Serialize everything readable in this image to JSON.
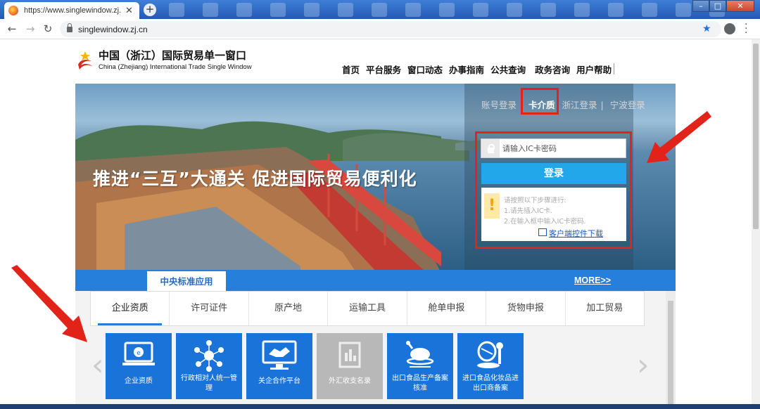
{
  "browser": {
    "tab_title": "https://www.singlewindow.zj.c",
    "url": "singlewindow.zj.cn"
  },
  "header": {
    "logo_cn": "中国（浙江）国际贸易单一窗口",
    "logo_en": "China (Zhejiang) International Trade Single Window",
    "nav": [
      "首页",
      "平台服务",
      "窗口动态",
      "办事指南",
      "公共查询",
      "政务咨询",
      "用户帮助"
    ]
  },
  "banner": {
    "slogan": "推进“三互”大通关  促进国际贸易便利化"
  },
  "login": {
    "tabs": [
      "账号登录",
      "卡介质",
      "浙江登录",
      "宁波登录"
    ],
    "active_tab": "卡介质",
    "ic_placeholder": "请输入IC卡密码",
    "login_button": "登录",
    "tips": [
      "请按照以下步骤进行:",
      "1.请先插入IC卡.",
      "2.在输入框中输入IC卡密码."
    ],
    "download_link": "客户端控件下载"
  },
  "apps": {
    "section_tab": "中央标准应用",
    "more": "MORE>>",
    "categories": [
      "企业资质",
      "许可证件",
      "原产地",
      "运输工具",
      "舱单申报",
      "货物申报",
      "加工贸易"
    ],
    "tiles": [
      {
        "label": "企业资质",
        "icon": "monitor-icon",
        "disabled": false
      },
      {
        "label": "行政相对人统一管理",
        "icon": "people-network-icon",
        "disabled": false
      },
      {
        "label": "关企合作平台",
        "icon": "handshake-icon",
        "disabled": false
      },
      {
        "label": "外汇收支名录",
        "icon": "document-icon",
        "disabled": true
      },
      {
        "label": "出口食品生产备案核准",
        "icon": "roast-chicken-icon",
        "disabled": false
      },
      {
        "label": "进口食品化妆品进出口商备案",
        "icon": "cosmetics-icon",
        "disabled": false
      }
    ]
  },
  "colors": {
    "primary_blue": "#2680db",
    "tile_blue": "#1a73d9",
    "login_blue": "#22a7ea",
    "annotation_red": "#e2231a"
  }
}
